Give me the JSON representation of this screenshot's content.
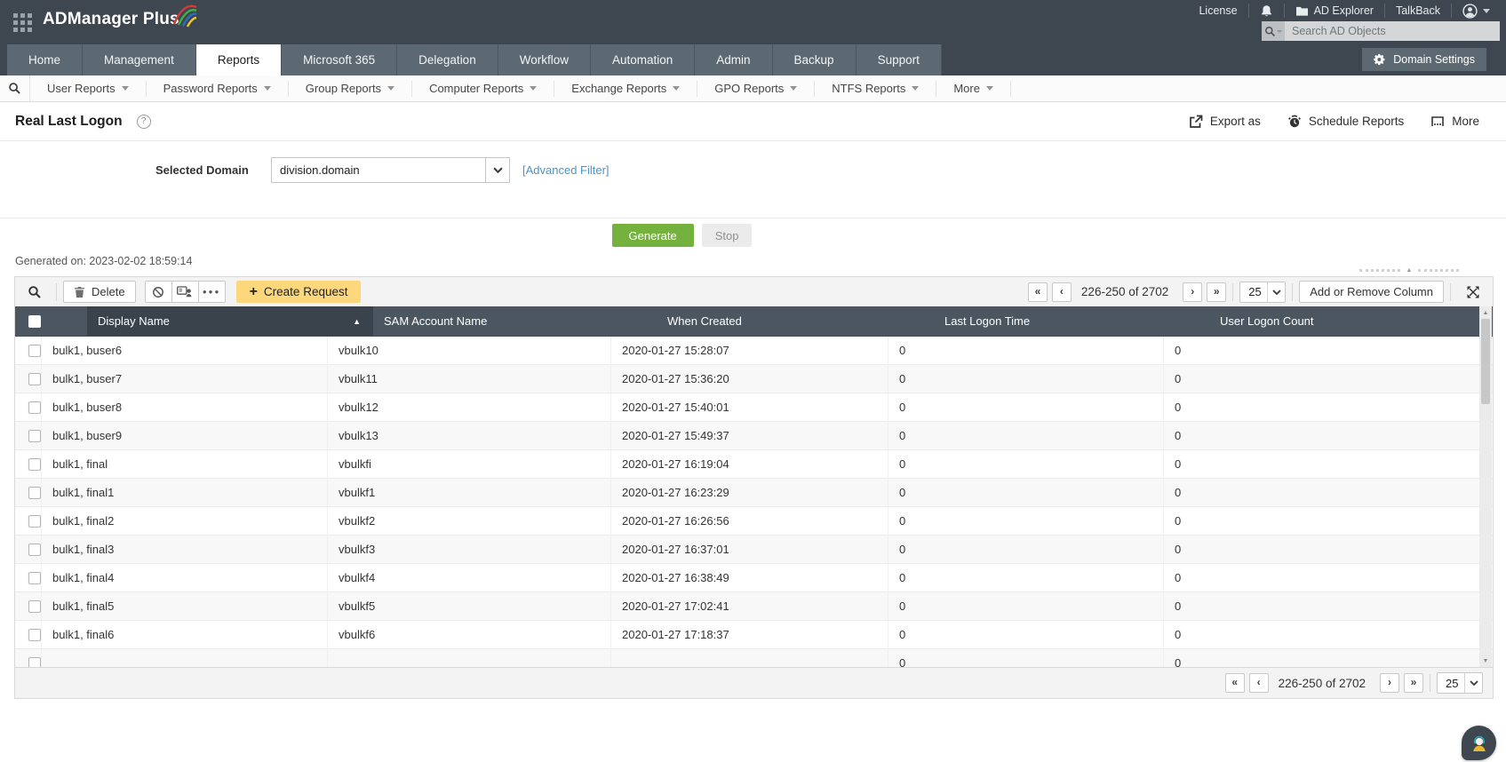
{
  "topbar": {
    "brand": "ADManager Plus",
    "license": "License",
    "ad_explorer": "AD Explorer",
    "talkback": "TalkBack",
    "search_placeholder": "Search AD Objects"
  },
  "nav": {
    "tabs": [
      {
        "label": "Home",
        "active": false
      },
      {
        "label": "Management",
        "active": false
      },
      {
        "label": "Reports",
        "active": true
      },
      {
        "label": "Microsoft 365",
        "active": false
      },
      {
        "label": "Delegation",
        "active": false
      },
      {
        "label": "Workflow",
        "active": false
      },
      {
        "label": "Automation",
        "active": false
      },
      {
        "label": "Admin",
        "active": false
      },
      {
        "label": "Backup",
        "active": false
      },
      {
        "label": "Support",
        "active": false
      }
    ],
    "domain_settings": "Domain Settings"
  },
  "subnav": {
    "items": [
      "User Reports",
      "Password Reports",
      "Group Reports",
      "Computer Reports",
      "Exchange Reports",
      "GPO Reports",
      "NTFS Reports",
      "More"
    ]
  },
  "page": {
    "title": "Real Last Logon",
    "actions": {
      "export_as": "Export as",
      "schedule_reports": "Schedule Reports",
      "more": "More"
    },
    "selected_domain_label": "Selected Domain",
    "domain_value": "division.domain",
    "advanced_filter": "[Advanced Filter]",
    "generate": "Generate",
    "stop": "Stop",
    "generated_on": "Generated on: 2023-02-02 18:59:14"
  },
  "table": {
    "toolbar": {
      "delete": "Delete",
      "create_request": "Create Request",
      "add_or_remove_column": "Add or Remove Column"
    },
    "pagination": {
      "range": "226-250 of 2702",
      "page_size": "25"
    },
    "columns": [
      "Display Name",
      "SAM Account Name",
      "When Created",
      "Last Logon Time",
      "User Logon Count"
    ],
    "rows": [
      {
        "display": "bulk1, buser6",
        "sam": "vbulk10",
        "created": "2020-01-27 15:28:07",
        "last_logon": "0",
        "logon_count": "0"
      },
      {
        "display": "bulk1, buser7",
        "sam": "vbulk11",
        "created": "2020-01-27 15:36:20",
        "last_logon": "0",
        "logon_count": "0"
      },
      {
        "display": "bulk1, buser8",
        "sam": "vbulk12",
        "created": "2020-01-27 15:40:01",
        "last_logon": "0",
        "logon_count": "0"
      },
      {
        "display": "bulk1, buser9",
        "sam": "vbulk13",
        "created": "2020-01-27 15:49:37",
        "last_logon": "0",
        "logon_count": "0"
      },
      {
        "display": "bulk1, final",
        "sam": "vbulkfi",
        "created": "2020-01-27 16:19:04",
        "last_logon": "0",
        "logon_count": "0"
      },
      {
        "display": "bulk1, final1",
        "sam": "vbulkf1",
        "created": "2020-01-27 16:23:29",
        "last_logon": "0",
        "logon_count": "0"
      },
      {
        "display": "bulk1, final2",
        "sam": "vbulkf2",
        "created": "2020-01-27 16:26:56",
        "last_logon": "0",
        "logon_count": "0"
      },
      {
        "display": "bulk1, final3",
        "sam": "vbulkf3",
        "created": "2020-01-27 16:37:01",
        "last_logon": "0",
        "logon_count": "0"
      },
      {
        "display": "bulk1, final4",
        "sam": "vbulkf4",
        "created": "2020-01-27 16:38:49",
        "last_logon": "0",
        "logon_count": "0"
      },
      {
        "display": "bulk1, final5",
        "sam": "vbulkf5",
        "created": "2020-01-27 17:02:41",
        "last_logon": "0",
        "logon_count": "0"
      },
      {
        "display": "bulk1, final6",
        "sam": "vbulkf6",
        "created": "2020-01-27 17:18:37",
        "last_logon": "0",
        "logon_count": "0"
      },
      {
        "display": "",
        "sam": "",
        "created": "",
        "last_logon": "0",
        "logon_count": "0"
      }
    ]
  },
  "colors": {
    "header_dark": "#3e474f",
    "tab_gray": "#5d6972",
    "table_header": "#4c5660",
    "accent_green": "#74b23d",
    "create_yellow": "#fcd77c",
    "link_blue": "#4a94c8"
  }
}
